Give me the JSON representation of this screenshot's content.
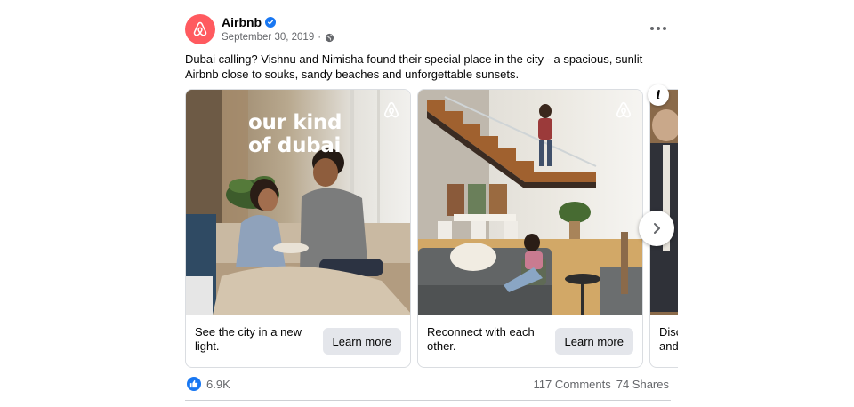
{
  "post": {
    "author": "Airbnb",
    "date": "September 30, 2019",
    "date_separator": "·",
    "caption": "Dubai calling? Vishnu and Nimisha found their special place in the city - a spacious, sunlit Airbnb close to souks, sandy beaches and unforgettable sunsets."
  },
  "cards": [
    {
      "overlay_line1": "our kind",
      "overlay_line2": "of dubai",
      "text": "See the city in a new light.",
      "button": "Learn more"
    },
    {
      "text": "Reconnect with each other.",
      "button": "Learn more"
    },
    {
      "text": "Disc and"
    }
  ],
  "footer": {
    "reactions_count": "6.9K",
    "comments": "117 Comments",
    "shares": "74 Shares"
  },
  "icons": {
    "brand_logo": "airbnb-logo",
    "verified": "verified-badge-icon",
    "privacy": "globe-icon",
    "more": "more-options-icon",
    "info": "info-icon",
    "next": "chevron-right-icon",
    "like": "like-icon"
  },
  "colors": {
    "brand": "#ff5a5f",
    "facebook_blue": "#1877f2",
    "secondary_text": "#65676b",
    "button_bg": "#e4e6eb"
  }
}
